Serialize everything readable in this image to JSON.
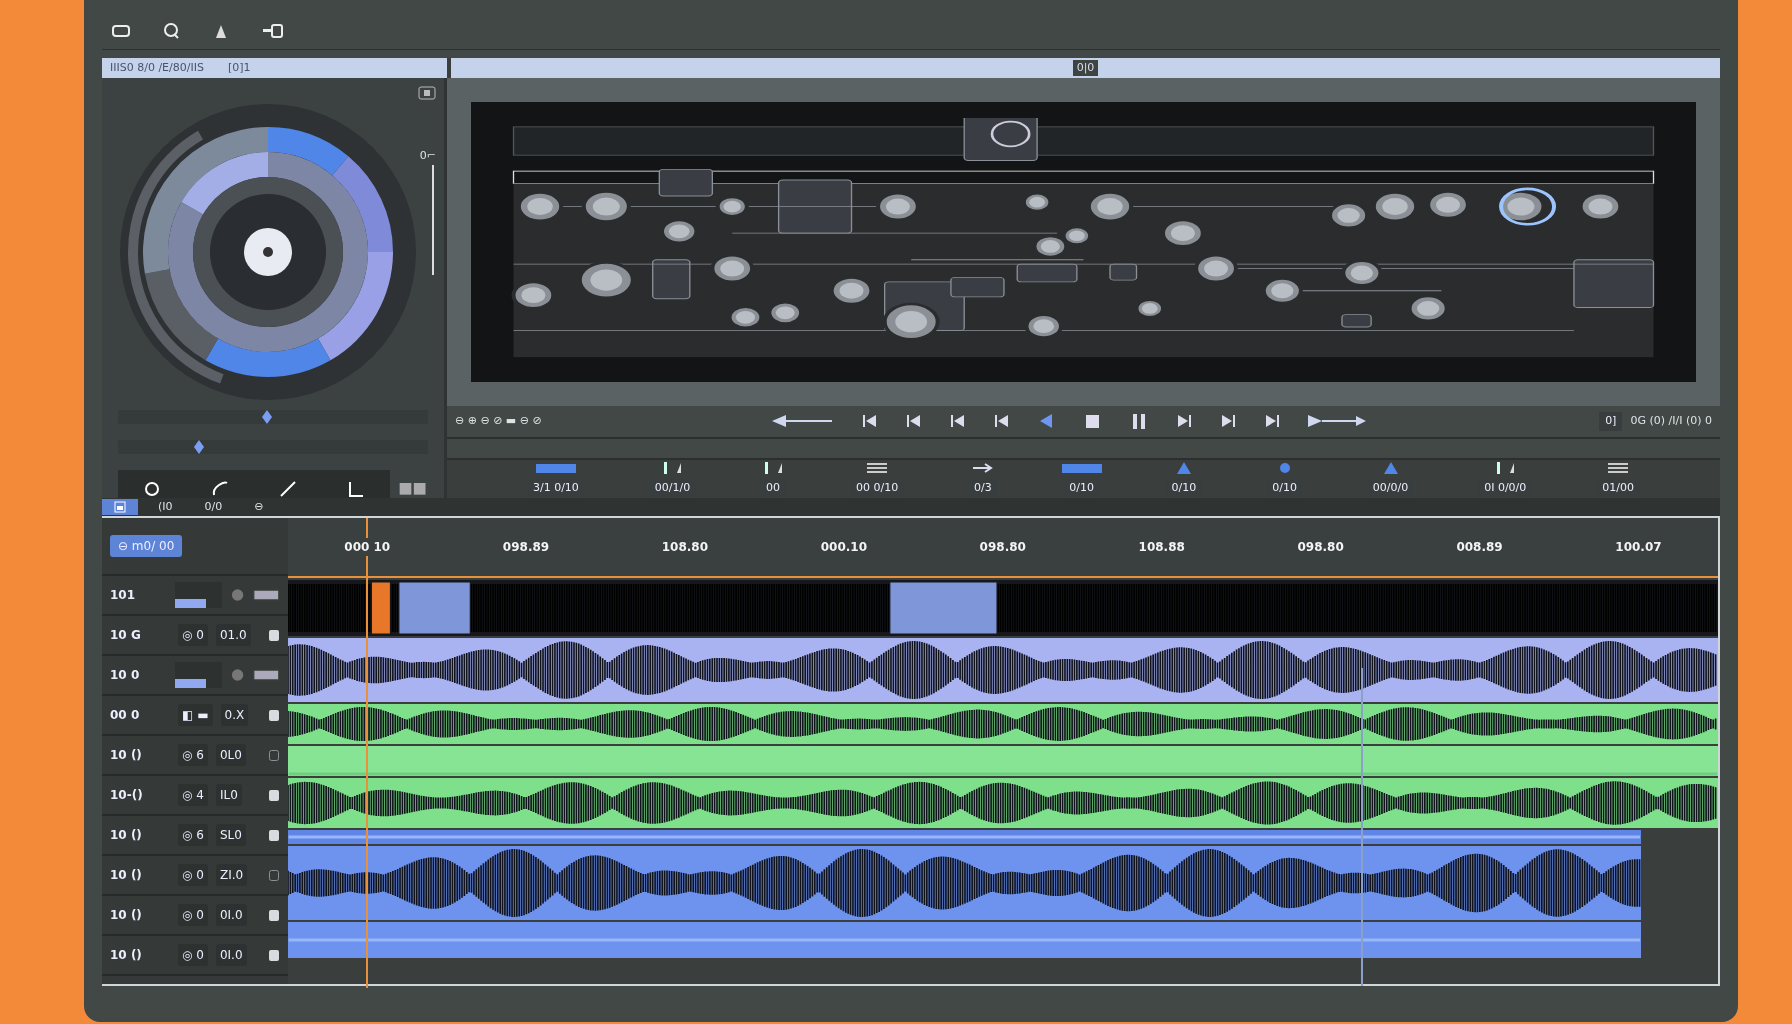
{
  "panels": {
    "left_title": "IIIS0 8/0 /E/80/IIS",
    "left_code": "[0]1",
    "center_code": "0|0"
  },
  "dial": {
    "label": "0⌐"
  },
  "sliders": [
    {
      "level": 0.48
    },
    {
      "level": 0.25
    }
  ],
  "tools": [
    {
      "kind": "circle"
    },
    {
      "kind": "curve"
    },
    {
      "kind": "line"
    },
    {
      "kind": "corner"
    }
  ],
  "tabs": [
    {
      "kind": "icon",
      "selected": true
    },
    {
      "kind": "text",
      "label": "(I0",
      "selected": false
    },
    {
      "kind": "text",
      "label": "0/0",
      "selected": false
    },
    {
      "kind": "text",
      "label": "⊖",
      "selected": false
    }
  ],
  "transport": {
    "left_readout": "⊖ ⊕ ⊖ ⊘ ▬ ⊖ ⊘",
    "buttons": [
      {
        "kind": "rewind"
      },
      {
        "kind": "start"
      },
      {
        "kind": "prev"
      },
      {
        "kind": "prev"
      },
      {
        "kind": "prev"
      },
      {
        "kind": "reverse",
        "selected": true
      },
      {
        "kind": "stop",
        "selected": false
      },
      {
        "kind": "pause",
        "selected": false
      },
      {
        "kind": "next",
        "selected": false
      },
      {
        "kind": "next",
        "selected": false
      },
      {
        "kind": "end",
        "selected": false
      },
      {
        "kind": "forward",
        "selected": false
      }
    ],
    "right_box": "0]",
    "right_readout": "0G (0) /I/I (0) 0"
  },
  "params": [
    {
      "kind": "bar",
      "label": "3/1 0/10"
    },
    {
      "kind": "tick",
      "label": "00/1/0"
    },
    {
      "kind": "tick",
      "label": "00"
    },
    {
      "kind": "lines",
      "label": "00 0/10"
    },
    {
      "kind": "arrow",
      "label": "0/3"
    },
    {
      "kind": "bar",
      "label": "0/10"
    },
    {
      "kind": "tri",
      "label": "0/10"
    },
    {
      "kind": "dot",
      "label": "0/10"
    },
    {
      "kind": "tri",
      "label": "00/0/0"
    },
    {
      "kind": "tick",
      "label": "0I 0/0/0"
    },
    {
      "kind": "lines",
      "label": "01/00"
    }
  ],
  "timeline": {
    "tag": "⊖ m0/ 00",
    "ruler": [
      "000 10",
      "098.89",
      "108.80",
      "000.10",
      "098.80",
      "108.88",
      "098.80",
      "008.89",
      "100.07"
    ]
  },
  "tracks": [
    {
      "name": "101",
      "kind": "fader",
      "level": 0.65
    },
    {
      "name": "10 G",
      "kind": "buttons",
      "buttons": "◎ 0",
      "value": "01.0",
      "locked": true
    },
    {
      "name": "10 0",
      "kind": "fader",
      "level": 0.65
    },
    {
      "name": "00 0",
      "kind": "buttons",
      "buttons": "◧ ▬",
      "value": "0.X",
      "locked": true
    },
    {
      "name": "10 ()",
      "kind": "buttons",
      "buttons": "◎ 6",
      "value": "0L0",
      "locked": false
    },
    {
      "name": "10-()",
      "kind": "buttons",
      "buttons": "◎ 4",
      "value": "IL0",
      "locked": true
    },
    {
      "name": "10 ()",
      "kind": "buttons",
      "buttons": "◎ 6",
      "value": "SL0",
      "locked": true
    },
    {
      "name": "10 ()",
      "kind": "buttons",
      "buttons": "◎ 0",
      "value": "ZI.0",
      "locked": false
    },
    {
      "name": "10 ()",
      "kind": "buttons",
      "buttons": "◎ 0",
      "value": "0I.0",
      "locked": true
    },
    {
      "name": "10 ()",
      "kind": "buttons",
      "buttons": "◎ 0",
      "value": "0I.0",
      "locked": true
    }
  ],
  "lanes": [
    {
      "kind": "clips",
      "color": "#16181c"
    },
    {
      "kind": "wave",
      "color": "#a9b3f2"
    },
    {
      "kind": "wave",
      "color": "#7ee08a"
    },
    {
      "kind": "flat",
      "color": "#86e494"
    },
    {
      "kind": "wave",
      "color": "#7ee08a"
    },
    {
      "kind": "stripe",
      "color": "#5f86e6"
    },
    {
      "kind": "wave",
      "color": "#6d93ee"
    },
    {
      "kind": "stripe",
      "color": "#6d93ee"
    }
  ]
}
